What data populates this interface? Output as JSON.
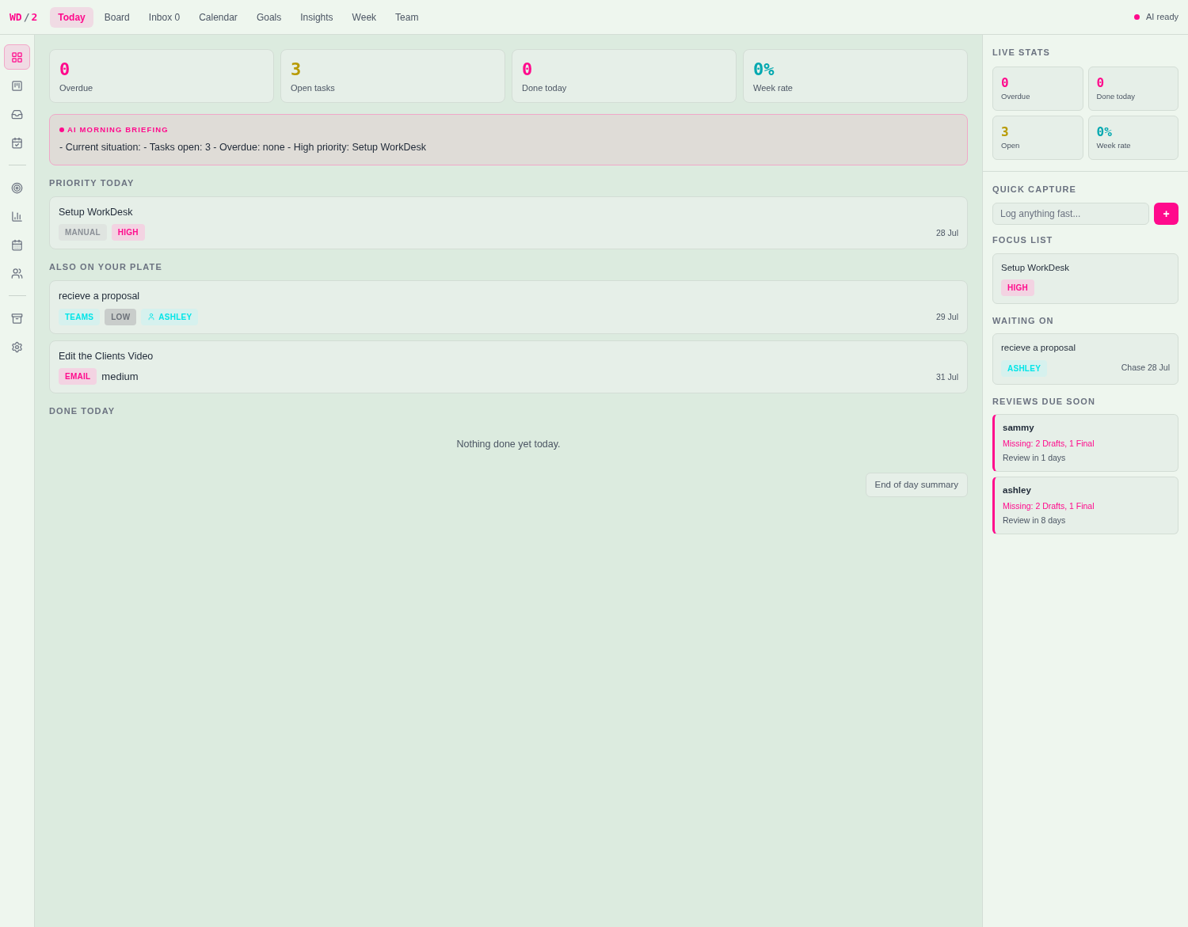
{
  "logo": {
    "primary": "WD",
    "separator": "/",
    "secondary": "2"
  },
  "nav": [
    {
      "label": "Today",
      "selected": true
    },
    {
      "label": "Board",
      "selected": false
    },
    {
      "label": "Inbox 0",
      "selected": false
    },
    {
      "label": "Calendar",
      "selected": false
    },
    {
      "label": "Goals",
      "selected": false
    },
    {
      "label": "Insights",
      "selected": false
    },
    {
      "label": "Week",
      "selected": false
    },
    {
      "label": "Team",
      "selected": false
    }
  ],
  "status": {
    "label": "AI ready",
    "color": "#ff0a8c"
  },
  "sidebar": {
    "groups": [
      [
        {
          "selected": true
        },
        {
          "selected": false
        },
        {
          "selected": false
        },
        {
          "selected": false
        }
      ],
      [
        {
          "selected": false
        },
        {
          "selected": false
        },
        {
          "selected": false
        },
        {
          "selected": false
        }
      ],
      [
        {
          "selected": false
        },
        {
          "selected": false
        }
      ]
    ]
  },
  "stats": [
    {
      "value": "0",
      "label": "Overdue",
      "color": "#ff0a8c"
    },
    {
      "value": "3",
      "label": "Open tasks",
      "color": "#b89a00"
    },
    {
      "value": "0",
      "label": "Done today",
      "color": "#ff0a8c"
    },
    {
      "value": "0%",
      "label": "Week rate",
      "color": "#00a8b0"
    }
  ],
  "briefing": {
    "title": "AI MORNING BRIEFING",
    "text": "- Current situation: - Tasks open: 3 - Overdue: none - High priority: Setup WorkDesk"
  },
  "sections": [
    {
      "title": "PRIORITY TODAY",
      "tasks": [
        {
          "title": "Setup WorkDesk",
          "date": "28 Jul",
          "tags": [
            {
              "label": "MANUAL",
              "kind": "gray"
            },
            {
              "label": "HIGH",
              "kind": "pink"
            }
          ]
        }
      ]
    },
    {
      "title": "ALSO ON YOUR PLATE",
      "tasks": [
        {
          "title": "recieve a proposal",
          "date": "29 Jul",
          "tags": [
            {
              "label": "TEAMS",
              "kind": "cyan"
            },
            {
              "label": "LOW",
              "kind": "dark"
            },
            {
              "label": "ASHLEY",
              "kind": "person"
            }
          ]
        },
        {
          "title": "Edit the Clients Video",
          "date": "31 Jul",
          "tags": [
            {
              "label": "EMAIL",
              "kind": "pink"
            },
            {
              "label": "medium",
              "kind": "plain"
            }
          ]
        }
      ]
    }
  ],
  "done": {
    "title": "DONE TODAY",
    "empty": "Nothing done yet today."
  },
  "summary_button": "End of day summary",
  "panel": {
    "live_stats": {
      "title": "LIVE STATS",
      "items": [
        {
          "value": "0",
          "label": "Overdue",
          "color": "#ff0a8c"
        },
        {
          "value": "0",
          "label": "Done today",
          "color": "#ff0a8c"
        },
        {
          "value": "3",
          "label": "Open",
          "color": "#b89a00"
        },
        {
          "value": "0%",
          "label": "Week rate",
          "color": "#00a8b0"
        }
      ]
    },
    "quick_capture": {
      "title": "QUICK CAPTURE",
      "placeholder": "Log anything fast...",
      "button": "+"
    },
    "focus_list": {
      "title": "FOCUS LIST",
      "items": [
        {
          "title": "Setup WorkDesk",
          "tags": [
            {
              "label": "HIGH",
              "kind": "pink"
            }
          ]
        }
      ]
    },
    "waiting_on": {
      "title": "WAITING ON",
      "items": [
        {
          "title": "recieve a proposal",
          "tag": {
            "label": "ASHLEY",
            "kind": "cyan"
          },
          "chase": "Chase 28 Jul"
        }
      ]
    },
    "reviews": {
      "title": "REVIEWS DUE SOON",
      "items": [
        {
          "name": "sammy",
          "missing": "Missing: 2 Drafts, 1 Final",
          "due": "Review in 1 days"
        },
        {
          "name": "ashley",
          "missing": "Missing: 2 Drafts, 1 Final",
          "due": "Review in 8 days"
        }
      ]
    }
  }
}
